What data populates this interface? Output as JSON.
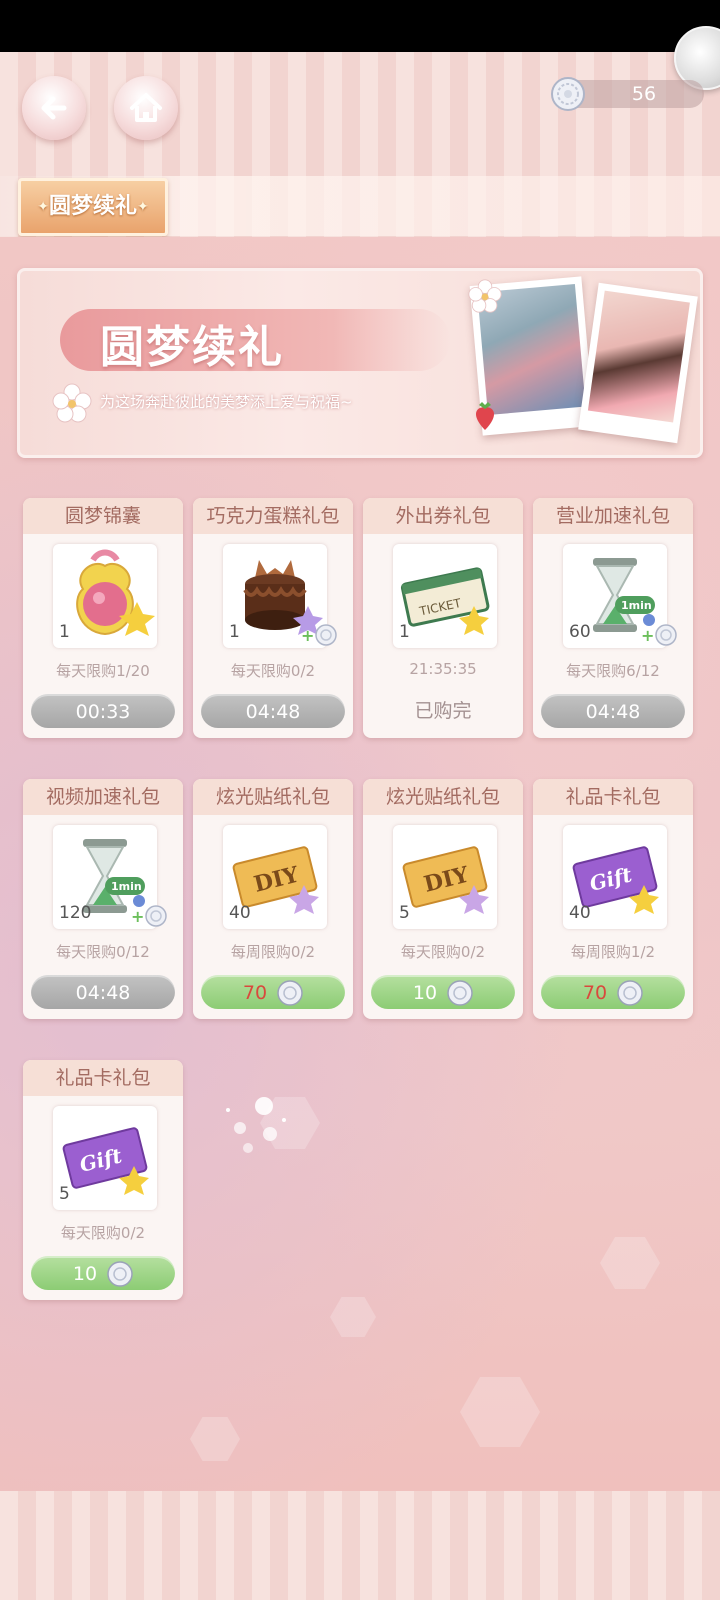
{
  "header": {
    "currency_amount": "56",
    "currency_icon": "silver-coin-icon"
  },
  "tabs": [
    {
      "label": "圆梦续礼",
      "active": true
    }
  ],
  "banner": {
    "title": "圆梦续礼",
    "subtitle": "为这场奔赴彼此的美梦添上爱与祝福~"
  },
  "products": [
    {
      "name": "圆梦锦囊",
      "icon": "pink-pouch-icon",
      "count": "1",
      "limit": "每天限购1/20",
      "button_type": "timer",
      "button_label": "00:33"
    },
    {
      "name": "巧克力蛋糕礼包",
      "icon": "chocolate-cake-icon",
      "count": "1",
      "limit": "每天限购0/2",
      "button_type": "timer",
      "button_label": "04:48",
      "bonus": true
    },
    {
      "name": "外出券礼包",
      "icon": "ticket-icon",
      "count": "1",
      "limit": "21:35:35",
      "button_type": "sold_out",
      "button_label": "已购完"
    },
    {
      "name": "营业加速礼包",
      "icon": "hourglass-icon",
      "count": "60",
      "limit": "每天限购6/12",
      "button_type": "timer",
      "button_label": "04:48",
      "bonus": true
    },
    {
      "name": "视频加速礼包",
      "icon": "hourglass-icon",
      "count": "120",
      "limit": "每天限购0/12",
      "button_type": "timer",
      "button_label": "04:48",
      "bonus": true
    },
    {
      "name": "炫光贴纸礼包",
      "icon": "diy-sticker-icon",
      "count": "40",
      "limit": "每周限购0/2",
      "button_type": "price",
      "button_label": "70",
      "price_red": true
    },
    {
      "name": "炫光贴纸礼包",
      "icon": "diy-sticker-icon",
      "count": "5",
      "limit": "每天限购0/2",
      "button_type": "price",
      "button_label": "10",
      "price_red": false
    },
    {
      "name": "礼品卡礼包",
      "icon": "gift-card-icon",
      "count": "40",
      "limit": "每周限购1/2",
      "button_type": "price",
      "button_label": "70",
      "price_red": true
    },
    {
      "name": "礼品卡礼包",
      "icon": "gift-card-icon",
      "count": "5",
      "limit": "每天限购0/2",
      "button_type": "price",
      "button_label": "10",
      "price_red": false
    }
  ],
  "colors": {
    "card_header_bg": "#f6dfd6",
    "card_header_text": "#a36b61",
    "timer_button": "#b5b5b5",
    "price_button": "#9fd689",
    "price_red_text": "#d9493d",
    "tab_active": "#eeb07c"
  }
}
